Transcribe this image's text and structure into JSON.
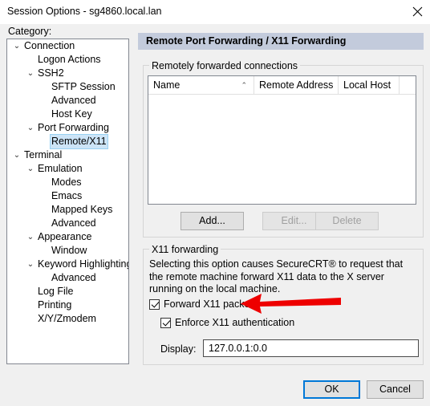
{
  "window": {
    "title": "Session Options - sg4860.local.lan",
    "close_icon": "close-icon"
  },
  "sidebar": {
    "label": "Category:",
    "items": [
      {
        "label": "Connection",
        "indent": 0,
        "chevron": "⌄",
        "selected": false
      },
      {
        "label": "Logon Actions",
        "indent": 1,
        "chevron": "",
        "selected": false
      },
      {
        "label": "SSH2",
        "indent": 1,
        "chevron": "⌄",
        "selected": false
      },
      {
        "label": "SFTP Session",
        "indent": 2,
        "chevron": "",
        "selected": false
      },
      {
        "label": "Advanced",
        "indent": 2,
        "chevron": "",
        "selected": false
      },
      {
        "label": "Host Key",
        "indent": 2,
        "chevron": "",
        "selected": false
      },
      {
        "label": "Port Forwarding",
        "indent": 1,
        "chevron": "⌄",
        "selected": false
      },
      {
        "label": "Remote/X11",
        "indent": 2,
        "chevron": "",
        "selected": true
      },
      {
        "label": "Terminal",
        "indent": 0,
        "chevron": "⌄",
        "selected": false
      },
      {
        "label": "Emulation",
        "indent": 1,
        "chevron": "⌄",
        "selected": false
      },
      {
        "label": "Modes",
        "indent": 2,
        "chevron": "",
        "selected": false
      },
      {
        "label": "Emacs",
        "indent": 2,
        "chevron": "",
        "selected": false
      },
      {
        "label": "Mapped Keys",
        "indent": 2,
        "chevron": "",
        "selected": false
      },
      {
        "label": "Advanced",
        "indent": 2,
        "chevron": "",
        "selected": false
      },
      {
        "label": "Appearance",
        "indent": 1,
        "chevron": "⌄",
        "selected": false
      },
      {
        "label": "Window",
        "indent": 2,
        "chevron": "",
        "selected": false
      },
      {
        "label": "Keyword Highlighting",
        "indent": 1,
        "chevron": "⌄",
        "selected": false
      },
      {
        "label": "Advanced",
        "indent": 2,
        "chevron": "",
        "selected": false
      },
      {
        "label": "Log File",
        "indent": 1,
        "chevron": "",
        "selected": false
      },
      {
        "label": "Printing",
        "indent": 1,
        "chevron": "",
        "selected": false
      },
      {
        "label": "X/Y/Zmodem",
        "indent": 1,
        "chevron": "",
        "selected": false
      }
    ]
  },
  "main": {
    "header": "Remote Port Forwarding / X11 Forwarding",
    "remote_group": {
      "legend": "Remotely forwarded connections",
      "columns": [
        {
          "label": "Name",
          "sort": "⌃"
        },
        {
          "label": "Remote Address",
          "sort": ""
        },
        {
          "label": "Local Host",
          "sort": ""
        },
        {
          "label": "",
          "sort": ""
        }
      ],
      "rows": [],
      "buttons": [
        {
          "label": "Add...",
          "enabled": true
        },
        {
          "label": "Edit...",
          "enabled": false
        },
        {
          "label": "Delete",
          "enabled": false
        }
      ]
    },
    "x11_group": {
      "legend": "X11 forwarding",
      "description": "Selecting this option causes SecureCRT® to request that the remote machine forward X11 data to the X server running on the local machine.",
      "forward_checkbox": {
        "label": "Forward X11 packets",
        "checked": true
      },
      "enforce_checkbox": {
        "label": "Enforce X11 authentication",
        "checked": true
      },
      "display_label": "Display:",
      "display_value": "127.0.0.1:0.0"
    }
  },
  "footer": {
    "ok_label": "OK",
    "cancel_label": "Cancel"
  },
  "annotation": {
    "arrow_color": "#ee0000",
    "arrow_direction": "left",
    "points_at": "Forward X11 packets"
  },
  "colors": {
    "window_bg": "#f0f0f0",
    "titlebar_bg": "#ffffff",
    "header_bar": "#c3cbdc",
    "selection": "#cce4f7",
    "accent": "#0078d7",
    "annotation_red": "#ee0000"
  }
}
